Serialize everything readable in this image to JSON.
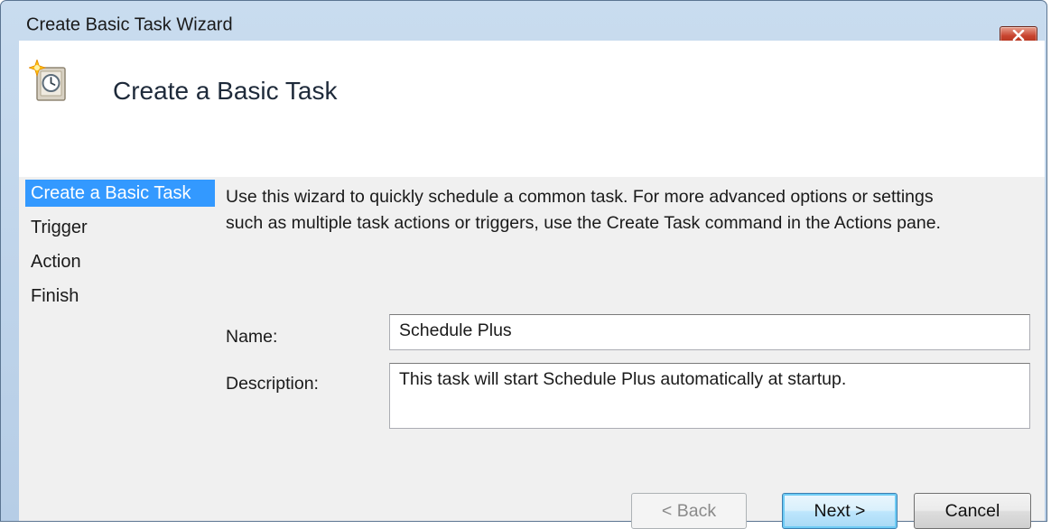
{
  "window": {
    "title": "Create Basic Task Wizard"
  },
  "header": {
    "title": "Create a Basic Task"
  },
  "steps": [
    {
      "label": "Create a Basic Task",
      "active": true
    },
    {
      "label": "Trigger",
      "active": false
    },
    {
      "label": "Action",
      "active": false
    },
    {
      "label": "Finish",
      "active": false
    }
  ],
  "intro": {
    "line1": "Use this wizard to quickly schedule a common task.  For more advanced options or settings",
    "line2": "such as multiple task actions or triggers, use the Create Task command in the Actions pane."
  },
  "form": {
    "name_label": "Name:",
    "name_value": "Schedule Plus",
    "description_label": "Description:",
    "description_value": "This task will start Schedule Plus automatically at startup."
  },
  "buttons": {
    "back": "< Back",
    "next": "Next >",
    "cancel": "Cancel"
  },
  "colors": {
    "selection": "#3399ff",
    "close_button": "#c8432e"
  },
  "icons": {
    "close": "close-icon",
    "task": "scheduled-task-clock-icon"
  }
}
